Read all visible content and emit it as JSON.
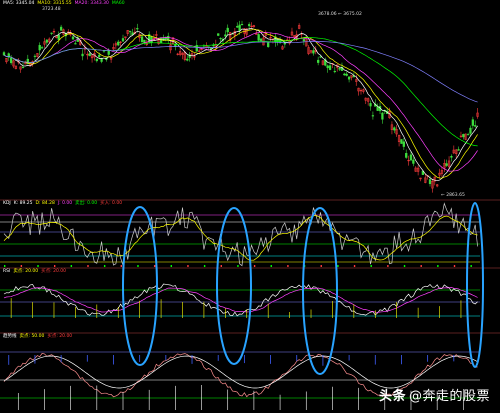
{
  "colors": {
    "background": "#000000",
    "candle_up": "#ff3c3c",
    "candle_down": "#3cdc3c",
    "ma_short": "#ffffff",
    "ma_mid": "#ffff00",
    "ma_long": "#ff40ff",
    "ma_longer": "#00ff00",
    "ma_longest": "#8080ff",
    "highlight_ring": "#29a3ff",
    "divider": "#5a2020"
  },
  "main_panel": {
    "legend": [
      {
        "text": "MA5: 3345.04",
        "color": "#ffffff"
      },
      {
        "text": "MA10: 3315.55",
        "color": "#ffff00"
      },
      {
        "text": "MA20: 3343.30",
        "color": "#ff40ff"
      },
      {
        "text": "MA60",
        "color": "#00ff00"
      }
    ],
    "label_high1": "3723.48",
    "label_high2": "3678.06 ← 3675.02",
    "label_low": "← 2863.65"
  },
  "kdj_panel": {
    "legend": [
      {
        "text": "KDJ",
        "color": "#ffffff"
      },
      {
        "text": "K: 89.25",
        "color": "#ffffff"
      },
      {
        "text": "D: 84.28",
        "color": "#ffff00"
      },
      {
        "text": "J: 0.00",
        "color": "#ff40ff"
      },
      {
        "text": "卖出: 0.00",
        "color": "#00ff00"
      },
      {
        "text": "买入: 0.00",
        "color": "#ff3c3c"
      }
    ]
  },
  "rsi_panel": {
    "legend": [
      {
        "text": "RSI",
        "color": "#ffffff"
      },
      {
        "text": "卖点: 20.00",
        "color": "#ffff00"
      },
      {
        "text": "买点: 20.00",
        "color": "#ff3c3c"
      }
    ]
  },
  "bottom_panel": {
    "legend": [
      {
        "text": "趋势线",
        "color": "#ffffff"
      },
      {
        "text": "卖点: 50.00",
        "color": "#ffff00"
      },
      {
        "text": "买点: 20.00",
        "color": "#ff3c3c"
      }
    ]
  },
  "watermark": {
    "brand": "头条",
    "handle": "@奔走的股票"
  }
}
